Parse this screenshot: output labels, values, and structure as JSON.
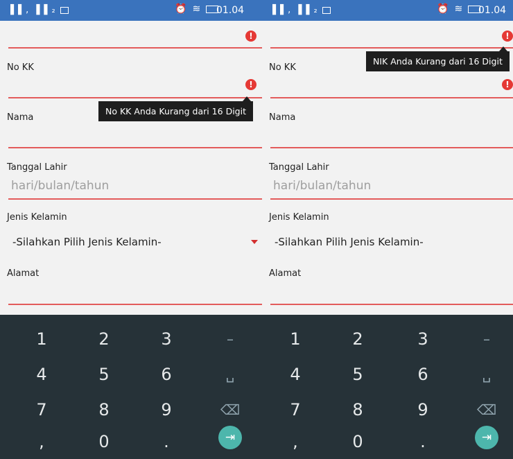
{
  "status_bar": {
    "signal": "▐▐ , ▐▐ ₂",
    "time": "01.04"
  },
  "form": {
    "no_kk_label": "No KK",
    "nama_label": "Nama",
    "tanggal_lahir_label": "Tanggal Lahir",
    "tanggal_lahir_placeholder": "hari/bulan/tahun",
    "jenis_kelamin_label": "Jenis Kelamin",
    "jenis_kelamin_value": "-Silahkan Pilih Jenis Kelamin-",
    "alamat_label": "Alamat"
  },
  "error_glyph": "!",
  "tooltips": {
    "no_kk_error": "No KK Anda Kurang dari 16 Digit",
    "nik_error": "NIK Anda Kurang dari 16 Digit"
  },
  "keyboard": {
    "rows": [
      [
        "1",
        "2",
        "3",
        "–"
      ],
      [
        "4",
        "5",
        "6",
        "␣"
      ],
      [
        "7",
        "8",
        "9",
        "⌫"
      ],
      [
        ",",
        "0",
        ".",
        "⇥"
      ]
    ]
  },
  "colors": {
    "accent": "#e53935",
    "status_bar": "#3a73bd",
    "keyboard_bg": "#263238",
    "go_key": "#4db6ac"
  }
}
